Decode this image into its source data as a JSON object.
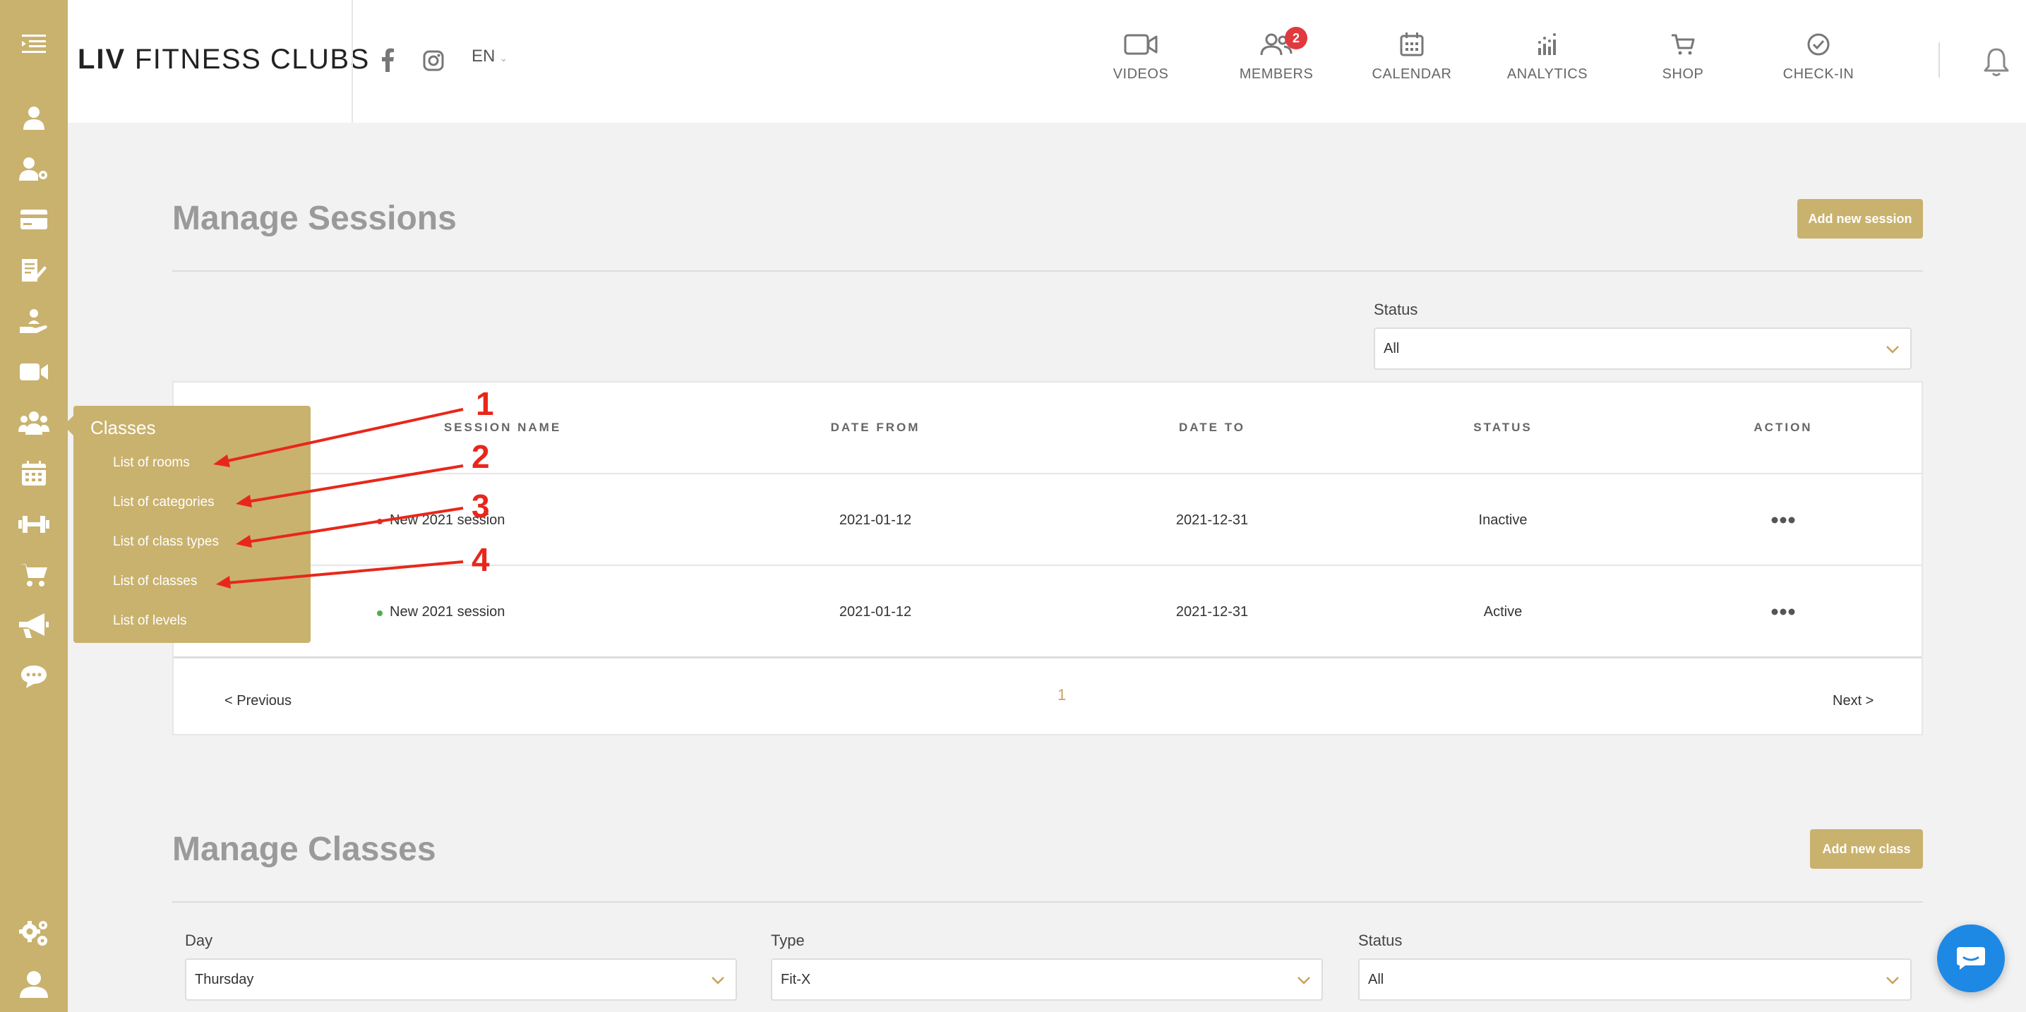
{
  "app": {
    "logo_bold": "LIV",
    "logo_rest": " FITNESS CLUBS",
    "language": "EN",
    "accent_color": "#c9b26e",
    "badge_color": "#e03a3e"
  },
  "sidebar": {
    "icons": [
      "menu-collapse-icon",
      "user-icon",
      "user-settings-icon",
      "credit-card-icon",
      "document-edit-icon",
      "hand-care-icon",
      "video-icon",
      "group-icon",
      "calendar-icon",
      "dumbbell-icon",
      "cart-icon",
      "megaphone-icon",
      "chat-bubble-icon",
      "settings-gears-icon",
      "profile-icon"
    ]
  },
  "nav": [
    {
      "label": "VIDEOS",
      "icon": "video-camera-icon"
    },
    {
      "label": "MEMBERS",
      "icon": "members-icon",
      "badge": "2"
    },
    {
      "label": "CALENDAR",
      "icon": "calendar-icon"
    },
    {
      "label": "ANALYTICS",
      "icon": "analytics-icon"
    },
    {
      "label": "SHOP",
      "icon": "shop-cart-icon"
    },
    {
      "label": "CHECK-IN",
      "icon": "check-circle-icon"
    }
  ],
  "sessions": {
    "title": "Manage Sessions",
    "add_button": "Add new session",
    "status_filter": {
      "label": "Status",
      "value": "All"
    },
    "columns": [
      "SESSION NAME",
      "DATE FROM",
      "DATE TO",
      "STATUS",
      "ACTION"
    ],
    "rows": [
      {
        "name": "New 2021 session",
        "date_from": "2021-01-12",
        "date_to": "2021-12-31",
        "status": "Inactive",
        "dot_color": "#e03a3e"
      },
      {
        "name": "New 2021 session",
        "date_from": "2021-01-12",
        "date_to": "2021-12-31",
        "status": "Active",
        "dot_color": "#4caf50"
      }
    ],
    "pagination": {
      "previous": "< Previous",
      "page": "1",
      "next": "Next >"
    }
  },
  "classes": {
    "title": "Manage Classes",
    "add_button": "Add new class",
    "filters": [
      {
        "label": "Day",
        "value": "Thursday"
      },
      {
        "label": "Type",
        "value": "Fit-X"
      },
      {
        "label": "Status",
        "value": "All"
      }
    ]
  },
  "popup": {
    "title": "Classes",
    "items": [
      "List of rooms",
      "List of categories",
      "List of class types",
      "List of classes",
      "List of levels"
    ]
  },
  "annotations": [
    "1",
    "2",
    "3",
    "4"
  ]
}
